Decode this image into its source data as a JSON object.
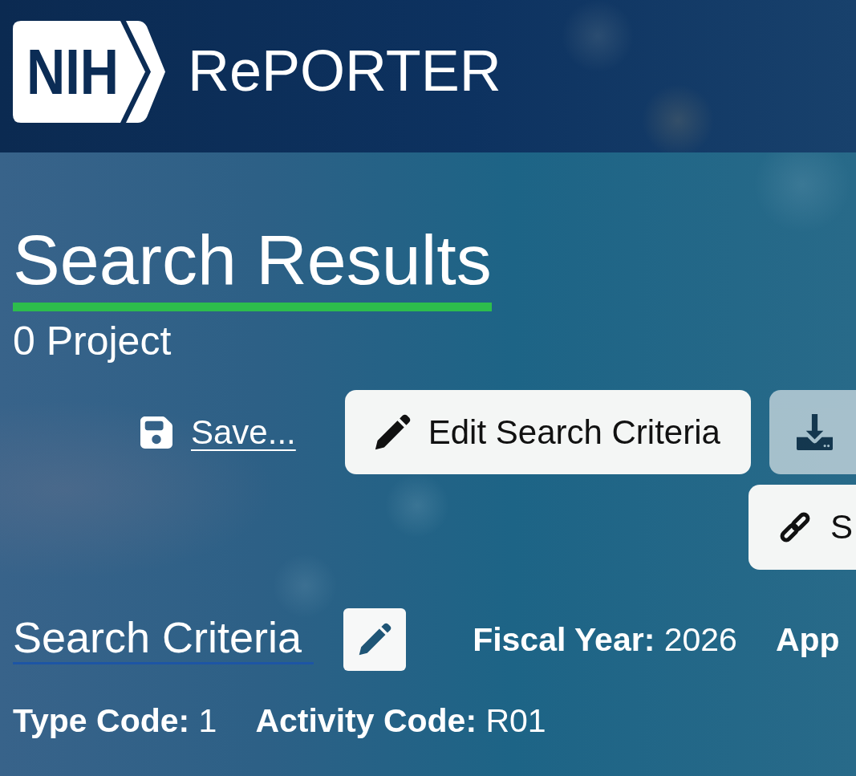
{
  "header": {
    "logo": "NIH",
    "title": "RePORTER"
  },
  "results": {
    "title": "Search Results",
    "count": "0 Project"
  },
  "actions": [
    {
      "kind": "save",
      "label": "Save...",
      "disabled": false
    },
    {
      "kind": "edit",
      "label": "Edit Search Criteria",
      "disabled": false
    },
    {
      "kind": "download",
      "disabled": true
    },
    {
      "kind": "share",
      "label": "S",
      "disabled": false
    }
  ],
  "search_criteria": {
    "title": "Search Criteria",
    "criteria": [
      {
        "label": "Fiscal Year:",
        "value": "2026"
      },
      {
        "label": "App"
      },
      {
        "label": "Type Code:",
        "value": "1"
      },
      {
        "label": "Activity Code:",
        "value": "R01"
      }
    ]
  }
}
